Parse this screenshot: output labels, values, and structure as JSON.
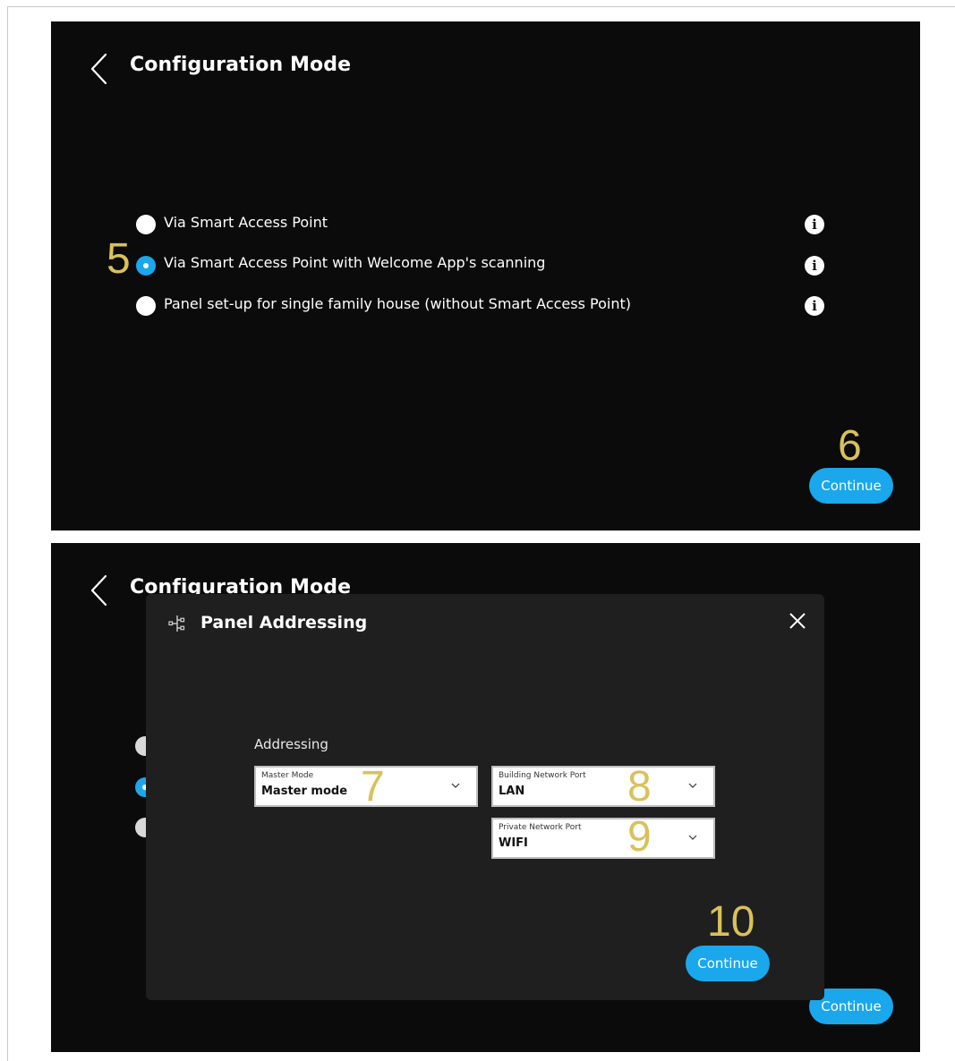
{
  "top_screen": {
    "title": "Configuration Mode",
    "options": [
      {
        "label": "Via Smart Access Point",
        "selected": false
      },
      {
        "label": "Via Smart Access Point with Welcome App's scanning",
        "selected": true
      },
      {
        "label": "Panel set-up for single family house (without Smart Access Point)",
        "selected": false
      }
    ],
    "info_glyph": "i",
    "continue_label": "Continue",
    "markers": {
      "options": "5",
      "continue": "6"
    }
  },
  "bottom_screen": {
    "title": "Configuration Mode",
    "continue_label": "Continue",
    "modal": {
      "title": "Panel Addressing",
      "icon": "network-nodes-icon",
      "section_label": "Addressing",
      "master_mode": {
        "label": "Master Mode",
        "value": "Master mode"
      },
      "building_port": {
        "label": "Building Network Port",
        "value": "LAN"
      },
      "private_port": {
        "label": "Private Network Port",
        "value": "WIFI"
      },
      "continue_label": "Continue",
      "markers": {
        "master": "7",
        "building": "8",
        "private": "9",
        "continue": "10"
      }
    }
  },
  "colors": {
    "background": "#0b0b0b",
    "modal": "#1f1f1f",
    "accent": "#1aa7ec",
    "marker": "#d8c15b",
    "text": "#ffffff"
  }
}
